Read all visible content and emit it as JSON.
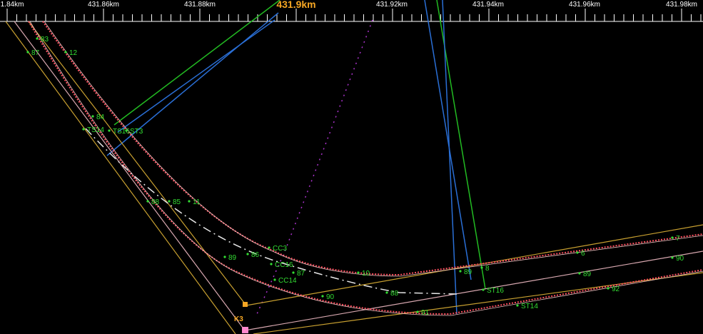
{
  "ruler": {
    "ticks": [
      "1.84km",
      "431.86km",
      "431.88km",
      "431.9km",
      "431.92km",
      "431.94km",
      "431.96km",
      "431.98km"
    ],
    "highlight_index": 3
  },
  "colors": {
    "background": "#000000",
    "ruler_text": "#ffffff",
    "accent": "#f5a623",
    "label": "#33dd33",
    "track_yellow": "#c8a030",
    "track_pink": "#d8a8b0",
    "track_red_dotted": "#ff5060",
    "line_green": "#22bb22",
    "line_blue": "#2a6fd6",
    "centerline": "#e8e8e8",
    "magenta": "#aa33cc"
  },
  "markers": {
    "k3": "K3"
  },
  "point_labels": [
    "83",
    "87",
    "12",
    "84",
    "TS14",
    "TS16",
    "ST3",
    "88",
    "85",
    "11",
    "89",
    "86",
    "CC3",
    "CC16",
    "87",
    "CC14",
    "10",
    "90",
    "88",
    "91",
    "89",
    "8",
    "ST16",
    "ST14",
    "6",
    "89",
    "92",
    "7",
    "90"
  ]
}
